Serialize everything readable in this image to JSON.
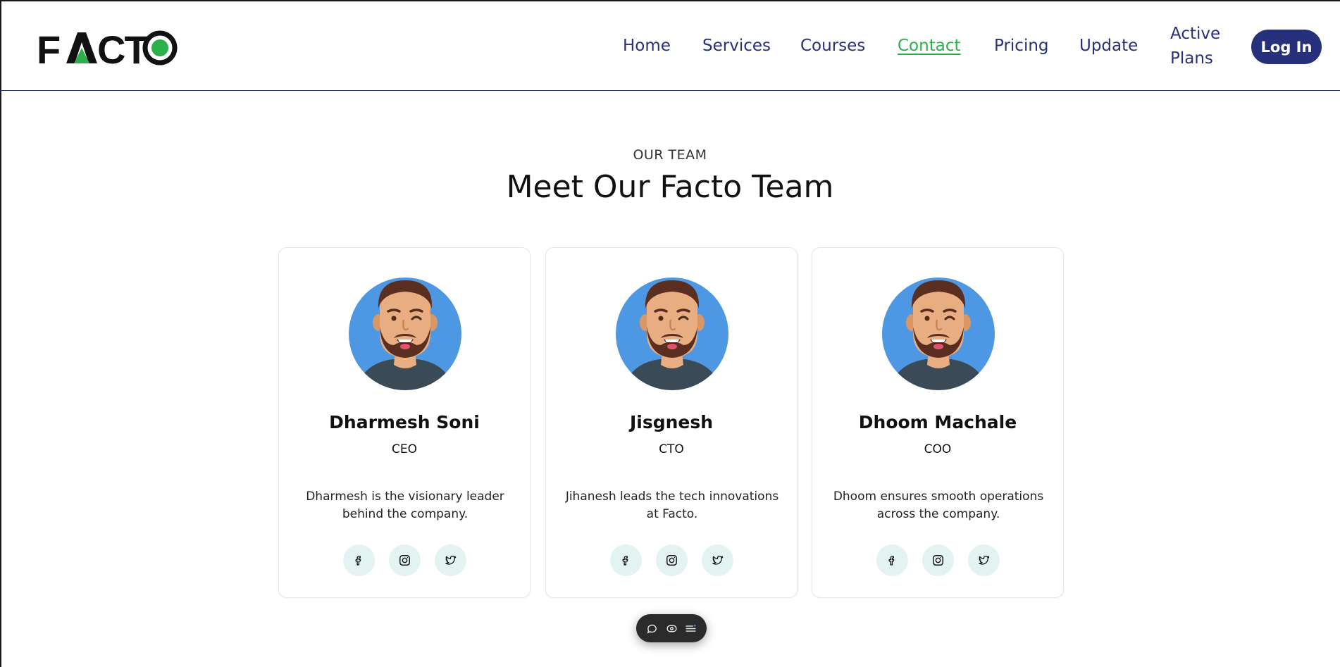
{
  "brand": {
    "logo_text": "FACTO",
    "accent": "#2bb04a",
    "primary": "#27307a"
  },
  "nav": {
    "home": "Home",
    "services": "Services",
    "courses": "Courses",
    "contact": "Contact",
    "pricing": "Pricing",
    "update": "Update",
    "active_plans_line1": "Active",
    "active_plans_line2": "Plans",
    "login": "Log In"
  },
  "section": {
    "eyebrow": "OUR TEAM",
    "title": "Meet Our Facto Team"
  },
  "team": [
    {
      "name": "Dharmesh Soni",
      "role": "CEO",
      "desc": "Dharmesh is the visionary leader behind the company."
    },
    {
      "name": "Jisgnesh",
      "role": "CTO",
      "desc": "Jihanesh leads the tech innovations at Facto."
    },
    {
      "name": "Dhoom Machale",
      "role": "COO",
      "desc": "Dhoom ensures smooth operations across the company."
    }
  ],
  "social_icons": [
    "facebook-icon",
    "instagram-icon",
    "twitter-icon"
  ],
  "toolbar_icons": [
    "comment-icon",
    "eye-icon",
    "menu-icon"
  ]
}
